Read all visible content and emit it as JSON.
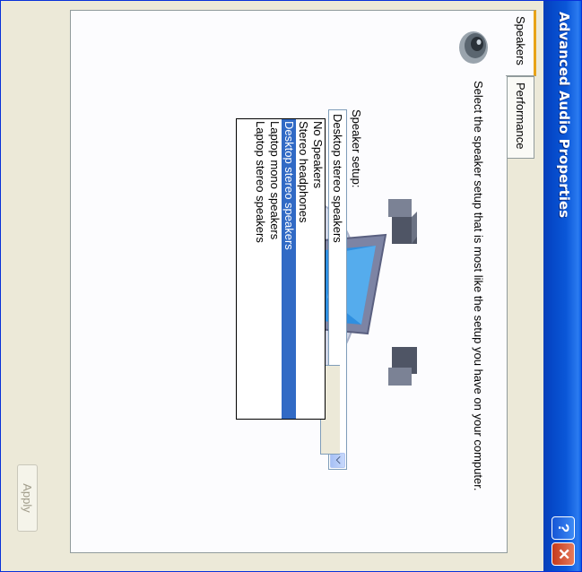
{
  "window": {
    "title": "Advanced Audio Properties",
    "help_label": "?",
    "close_label": "✕"
  },
  "tabs": [
    {
      "label": "Speakers",
      "active": true
    },
    {
      "label": "Performance",
      "active": false
    }
  ],
  "speakers_page": {
    "intro": "Select the speaker setup that is most like the setup you have on your computer.",
    "setup_label": "Speaker setup:",
    "setup_value": "Desktop stereo speakers",
    "options": [
      {
        "label": "No Speakers"
      },
      {
        "label": "Stereo headphones"
      },
      {
        "label": "Desktop stereo speakers",
        "selected": true
      },
      {
        "label": "Laptop mono speakers"
      },
      {
        "label": "Laptop stereo speakers"
      }
    ]
  },
  "buttons": {
    "apply_label": "Apply",
    "apply_enabled": false
  },
  "colors": {
    "titlebar": "#0a57d8",
    "selection": "#316ac5",
    "tab_highlight": "#e8a317"
  }
}
